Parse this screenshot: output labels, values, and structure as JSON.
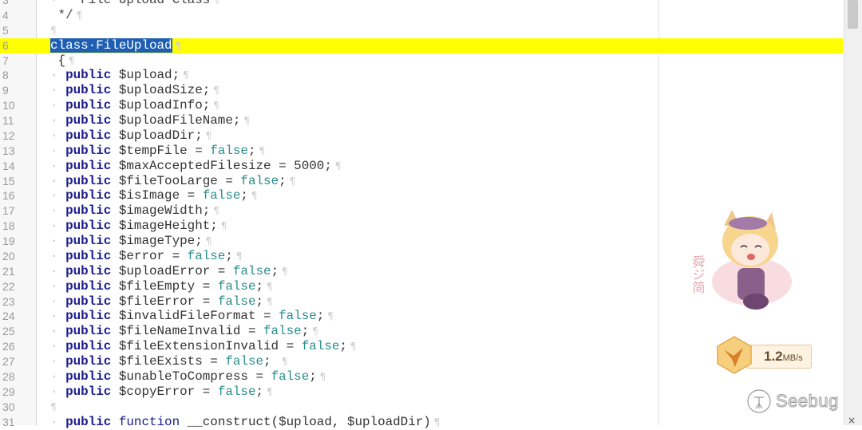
{
  "editor": {
    "lines": [
      {
        "num": "3",
        "indent": "  ",
        "tokens": [
          {
            "t": "* File Upload Class",
            "c": "cm"
          }
        ]
      },
      {
        "num": "4",
        "indent": " ",
        "tokens": [
          {
            "t": "*/",
            "c": "cm"
          }
        ]
      },
      {
        "num": "5",
        "indent": "",
        "tokens": []
      },
      {
        "num": "6",
        "indent": "",
        "highlight": true,
        "tokens": [
          {
            "t": "class·FileUpload",
            "c": "sel"
          }
        ]
      },
      {
        "num": "7",
        "indent": " ",
        "tokens": [
          {
            "t": "{",
            "c": "op"
          }
        ]
      },
      {
        "num": "8",
        "indent": "  ",
        "tokens": [
          {
            "t": "public",
            "c": "kw"
          },
          {
            "t": " $upload;",
            "c": "var"
          }
        ]
      },
      {
        "num": "9",
        "indent": "  ",
        "tokens": [
          {
            "t": "public",
            "c": "kw"
          },
          {
            "t": " $uploadSize;",
            "c": "var"
          }
        ]
      },
      {
        "num": "10",
        "indent": "  ",
        "tokens": [
          {
            "t": "public",
            "c": "kw"
          },
          {
            "t": " $uploadInfo;",
            "c": "var"
          }
        ]
      },
      {
        "num": "11",
        "indent": "  ",
        "tokens": [
          {
            "t": "public",
            "c": "kw"
          },
          {
            "t": " $uploadFileName;",
            "c": "var"
          }
        ]
      },
      {
        "num": "12",
        "indent": "  ",
        "tokens": [
          {
            "t": "public",
            "c": "kw"
          },
          {
            "t": " $uploadDir;",
            "c": "var"
          }
        ]
      },
      {
        "num": "13",
        "indent": "  ",
        "tokens": [
          {
            "t": "public",
            "c": "kw"
          },
          {
            "t": " $tempFile = ",
            "c": "var"
          },
          {
            "t": "false",
            "c": "bool"
          },
          {
            "t": ";",
            "c": "op"
          }
        ]
      },
      {
        "num": "14",
        "indent": "  ",
        "tokens": [
          {
            "t": "public",
            "c": "kw"
          },
          {
            "t": " $maxAcceptedFilesize = ",
            "c": "var"
          },
          {
            "t": "5000",
            "c": "num"
          },
          {
            "t": ";",
            "c": "op"
          }
        ]
      },
      {
        "num": "15",
        "indent": "  ",
        "tokens": [
          {
            "t": "public",
            "c": "kw"
          },
          {
            "t": " $fileTooLarge = ",
            "c": "var"
          },
          {
            "t": "false",
            "c": "bool"
          },
          {
            "t": ";",
            "c": "op"
          }
        ]
      },
      {
        "num": "16",
        "indent": "  ",
        "tokens": [
          {
            "t": "public",
            "c": "kw"
          },
          {
            "t": " $isImage = ",
            "c": "var"
          },
          {
            "t": "false",
            "c": "bool"
          },
          {
            "t": ";",
            "c": "op"
          }
        ]
      },
      {
        "num": "17",
        "indent": "  ",
        "tokens": [
          {
            "t": "public",
            "c": "kw"
          },
          {
            "t": " $imageWidth;",
            "c": "var"
          }
        ]
      },
      {
        "num": "18",
        "indent": "  ",
        "tokens": [
          {
            "t": "public",
            "c": "kw"
          },
          {
            "t": " $imageHeight;",
            "c": "var"
          }
        ]
      },
      {
        "num": "19",
        "indent": "  ",
        "tokens": [
          {
            "t": "public",
            "c": "kw"
          },
          {
            "t": " $imageType;",
            "c": "var"
          }
        ]
      },
      {
        "num": "20",
        "indent": "  ",
        "tokens": [
          {
            "t": "public",
            "c": "kw"
          },
          {
            "t": " $error = ",
            "c": "var"
          },
          {
            "t": "false",
            "c": "bool"
          },
          {
            "t": ";",
            "c": "op"
          }
        ]
      },
      {
        "num": "21",
        "indent": "  ",
        "tokens": [
          {
            "t": "public",
            "c": "kw"
          },
          {
            "t": " $uploadError = ",
            "c": "var"
          },
          {
            "t": "false",
            "c": "bool"
          },
          {
            "t": ";",
            "c": "op"
          }
        ]
      },
      {
        "num": "22",
        "indent": "  ",
        "tokens": [
          {
            "t": "public",
            "c": "kw"
          },
          {
            "t": " $fileEmpty = ",
            "c": "var"
          },
          {
            "t": "false",
            "c": "bool"
          },
          {
            "t": ";",
            "c": "op"
          }
        ]
      },
      {
        "num": "23",
        "indent": "  ",
        "tokens": [
          {
            "t": "public",
            "c": "kw"
          },
          {
            "t": " $fileError = ",
            "c": "var"
          },
          {
            "t": "false",
            "c": "bool"
          },
          {
            "t": ";",
            "c": "op"
          }
        ]
      },
      {
        "num": "24",
        "indent": "  ",
        "tokens": [
          {
            "t": "public",
            "c": "kw"
          },
          {
            "t": " $invalidFileFormat = ",
            "c": "var"
          },
          {
            "t": "false",
            "c": "bool"
          },
          {
            "t": ";",
            "c": "op"
          }
        ]
      },
      {
        "num": "25",
        "indent": "  ",
        "tokens": [
          {
            "t": "public",
            "c": "kw"
          },
          {
            "t": " $fileNameInvalid = ",
            "c": "var"
          },
          {
            "t": "false",
            "c": "bool"
          },
          {
            "t": ";",
            "c": "op"
          }
        ]
      },
      {
        "num": "26",
        "indent": "  ",
        "tokens": [
          {
            "t": "public",
            "c": "kw"
          },
          {
            "t": " $fileExtensionInvalid = ",
            "c": "var"
          },
          {
            "t": "false",
            "c": "bool"
          },
          {
            "t": ";",
            "c": "op"
          }
        ]
      },
      {
        "num": "27",
        "indent": "  ",
        "tokens": [
          {
            "t": "public",
            "c": "kw"
          },
          {
            "t": " $fileExists = ",
            "c": "var"
          },
          {
            "t": "false",
            "c": "bool"
          },
          {
            "t": "; ",
            "c": "op"
          }
        ]
      },
      {
        "num": "28",
        "indent": "  ",
        "tokens": [
          {
            "t": "public",
            "c": "kw"
          },
          {
            "t": " $unableToCompress = ",
            "c": "var"
          },
          {
            "t": "false",
            "c": "bool"
          },
          {
            "t": ";",
            "c": "op"
          }
        ]
      },
      {
        "num": "29",
        "indent": "  ",
        "tokens": [
          {
            "t": "public",
            "c": "kw"
          },
          {
            "t": " $copyError = ",
            "c": "var"
          },
          {
            "t": "false",
            "c": "bool"
          },
          {
            "t": ";",
            "c": "op"
          }
        ]
      },
      {
        "num": "30",
        "indent": "",
        "tokens": []
      },
      {
        "num": "31",
        "indent": "  ",
        "tokens": [
          {
            "t": "public",
            "c": "kw"
          },
          {
            "t": " ",
            "c": "op"
          },
          {
            "t": "function",
            "c": "fn"
          },
          {
            "t": " __construct($upload, $uploadDir)",
            "c": "var"
          }
        ]
      }
    ],
    "pilcrow": "¶",
    "highlight_color": "#ffff00",
    "selection_color": "#1e5fb3"
  },
  "overlay": {
    "speed_value": "1.2",
    "speed_unit": "MB/s",
    "watermark": "Seebug",
    "mascot_text": "舜ジ简"
  },
  "close_label": "×"
}
